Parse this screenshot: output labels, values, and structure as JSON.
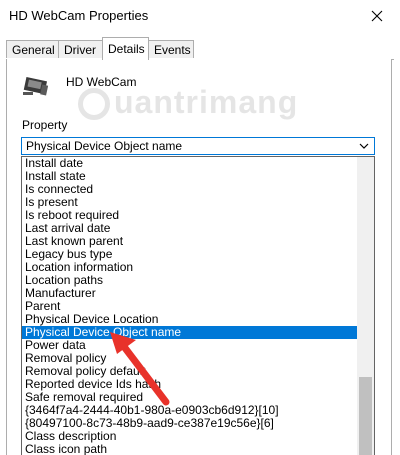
{
  "window": {
    "title": "HD WebCam Properties"
  },
  "tabs": [
    {
      "label": "General"
    },
    {
      "label": "Driver"
    },
    {
      "label": "Details",
      "active": true
    },
    {
      "label": "Events"
    }
  ],
  "device": {
    "name": "HD WebCam",
    "icon": "webcam-icon"
  },
  "watermark": {
    "text": "uantrimang"
  },
  "property": {
    "label": "Property",
    "selected_value": "Physical Device Object name",
    "options": [
      "Install date",
      "Install state",
      "Is connected",
      "Is present",
      "Is reboot required",
      "Last arrival date",
      "Last known parent",
      "Legacy bus type",
      "Location information",
      "Location paths",
      "Manufacturer",
      "Parent",
      "Physical Device Location",
      "Physical Device Object name",
      "Power data",
      "Removal policy",
      "Removal policy default",
      "Reported device Ids hash",
      "Safe removal required",
      "{3464f7a4-2444-40b1-980a-e0903cb6d912}[10]",
      "{80497100-8c73-48b9-aad9-ce387e19c56e}[6]",
      "Class description",
      "Class icon path"
    ],
    "highlighted_index": 13
  },
  "colors": {
    "accent": "#0078d7",
    "annotation_arrow": "#e8322a",
    "tab_border": "#adadad"
  }
}
